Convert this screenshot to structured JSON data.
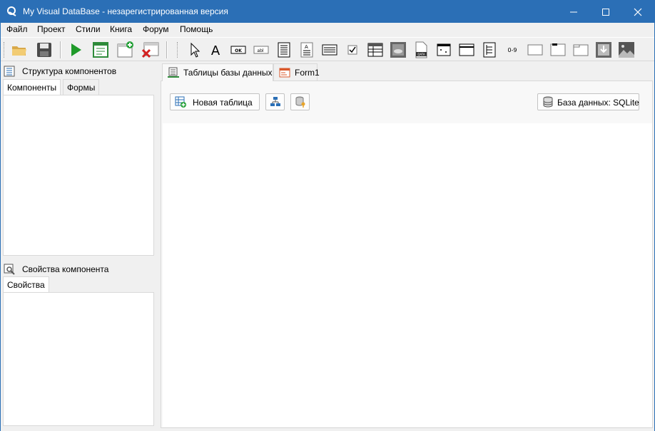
{
  "window": {
    "title": "My Visual DataBase - незарегистрированная версия",
    "accent_color": "#2b6fb6",
    "controls": [
      "minimize-icon",
      "maximize-icon",
      "close-icon"
    ]
  },
  "menu": {
    "items": [
      "Файл",
      "Проект",
      "Стили",
      "Книга",
      "Форум",
      "Помощь"
    ]
  },
  "toolbar": {
    "buttons": [
      "open-folder-icon",
      "save-icon",
      "run-icon",
      "form-properties-icon",
      "add-form-icon",
      "delete-form-icon",
      "pointer-icon",
      "label-icon",
      "button-icon",
      "edit-icon",
      "memo-icon",
      "text-icon",
      "combobox-icon",
      "checkbox-icon",
      "tablegrid-icon",
      "dbimage-icon",
      "dbfile-icon",
      "datetime-icon",
      "grid-icon",
      "treeview-icon",
      "counter-icon",
      "panel-icon",
      "groupbox-icon",
      "pagecontrol-icon",
      "download-icon",
      "image-icon"
    ],
    "texts": {
      "label": "A",
      "button": "OK",
      "edit": "abl",
      "counter": "0-9"
    }
  },
  "left": {
    "structure": {
      "title": "Структура компонентов",
      "tabs": [
        "Компоненты",
        "Формы"
      ]
    },
    "properties": {
      "title": "Свойства компонента",
      "tabs": [
        "Свойства"
      ]
    }
  },
  "right": {
    "tabs": [
      "Таблицы базы данных",
      "Form1"
    ],
    "buttons": {
      "new_table": "Новая таблица",
      "database": "База данных: SQLite"
    }
  }
}
